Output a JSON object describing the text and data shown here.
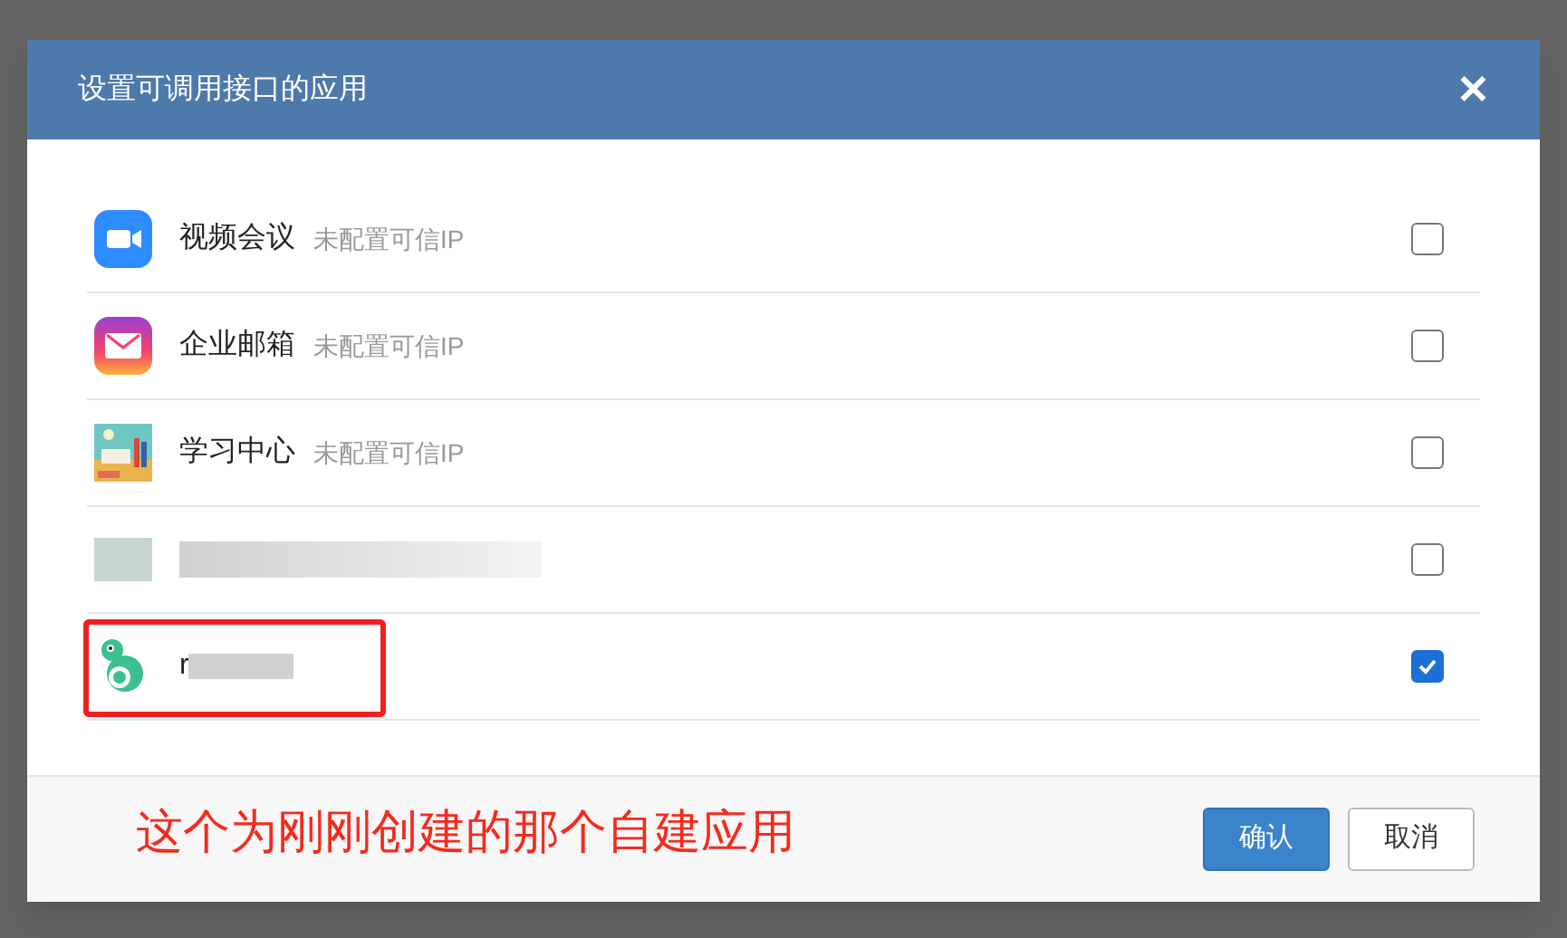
{
  "dialog": {
    "title": "设置可调用接口的应用",
    "close": "✕"
  },
  "apps": [
    {
      "kind": "video",
      "name": "视频会议",
      "status": "未配置可信IP",
      "checked": false,
      "highlighted": false
    },
    {
      "kind": "mail",
      "name": "企业邮箱",
      "status": "未配置可信IP",
      "checked": false,
      "highlighted": false
    },
    {
      "kind": "learning",
      "name": "学习中心",
      "status": "未配置可信IP",
      "checked": false,
      "highlighted": false
    },
    {
      "kind": "blurred",
      "checked": false,
      "highlighted": false
    },
    {
      "kind": "custom",
      "name": "r",
      "checked": true,
      "highlighted": true
    }
  ],
  "annotation": "这个为刚刚创建的那个自建应用",
  "buttons": [
    {
      "kind": "primary",
      "label": "确认"
    },
    {
      "kind": "secondary",
      "label": "取消"
    }
  ]
}
